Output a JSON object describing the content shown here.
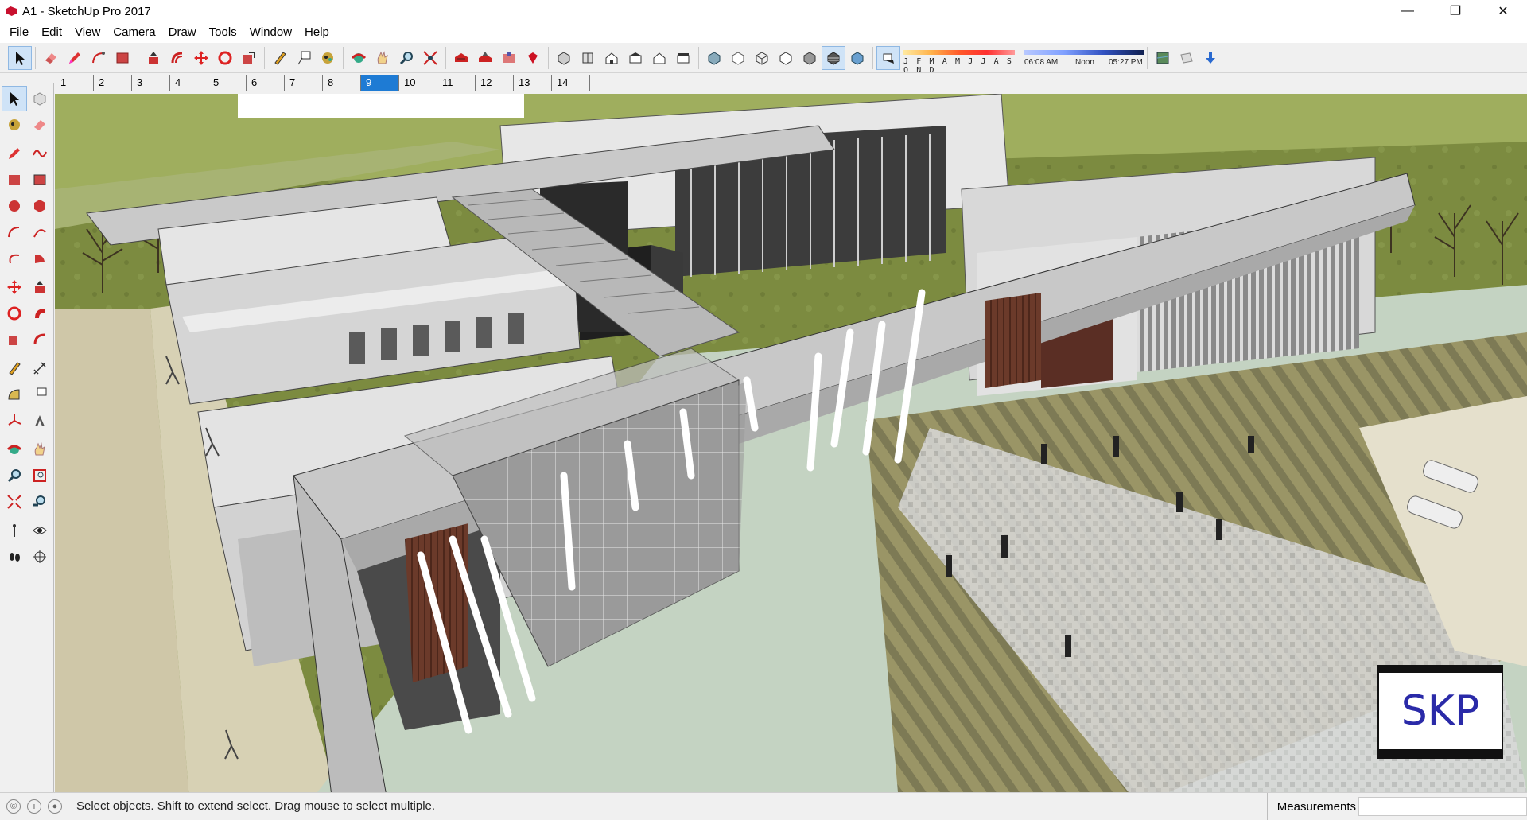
{
  "window": {
    "title": "A1 - SketchUp Pro 2017",
    "minimize": "—",
    "restore": "❐",
    "close": "✕"
  },
  "menu": [
    "File",
    "Edit",
    "View",
    "Camera",
    "Draw",
    "Tools",
    "Window",
    "Help"
  ],
  "toolbar": {
    "shadow_months": "J F M A M J J A S O N D",
    "time_start": "06:08 AM",
    "time_mid": "Noon",
    "time_end": "05:27 PM"
  },
  "scenes": [
    "1",
    "2",
    "3",
    "4",
    "5",
    "6",
    "7",
    "8",
    "9",
    "10",
    "11",
    "12",
    "13",
    "14"
  ],
  "active_scene": "9",
  "status": {
    "message": "Select objects. Shift to extend select. Drag mouse to select multiple.",
    "measurements_label": "Measurements",
    "measurements_value": ""
  },
  "watermark": "SKP",
  "colors": {
    "accent": "#1e7bd4",
    "grass": "#7a8b3e",
    "plaza": "#c7d5c5",
    "building": "#bdbdbd"
  }
}
